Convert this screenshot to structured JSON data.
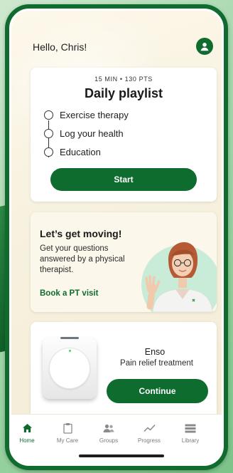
{
  "header": {
    "greeting": "Hello, Chris!"
  },
  "playlist": {
    "meta": "15 MIN • 130 PTS",
    "title": "Daily playlist",
    "tasks": [
      {
        "label": "Exercise therapy"
      },
      {
        "label": "Log your health"
      },
      {
        "label": "Education"
      }
    ],
    "start_label": "Start"
  },
  "moving": {
    "title": "Let’s get moving!",
    "description": "Get your questions answered by a physical therapist.",
    "link_label": "Book a PT visit"
  },
  "enso": {
    "name": "Enso",
    "subtitle": "Pain relief treatment",
    "continue_label": "Continue"
  },
  "tabbar": {
    "tabs": [
      {
        "label": "Home",
        "icon": "home-icon",
        "active": true
      },
      {
        "label": "My Care",
        "icon": "clipboard-icon",
        "active": false
      },
      {
        "label": "Groups",
        "icon": "groups-icon",
        "active": false
      },
      {
        "label": "Progress",
        "icon": "trend-icon",
        "active": false
      },
      {
        "label": "Library",
        "icon": "library-icon",
        "active": false
      }
    ]
  },
  "colors": {
    "brand": "#0e6c2f",
    "background": "#f7f1df",
    "card": "#ffffff"
  }
}
